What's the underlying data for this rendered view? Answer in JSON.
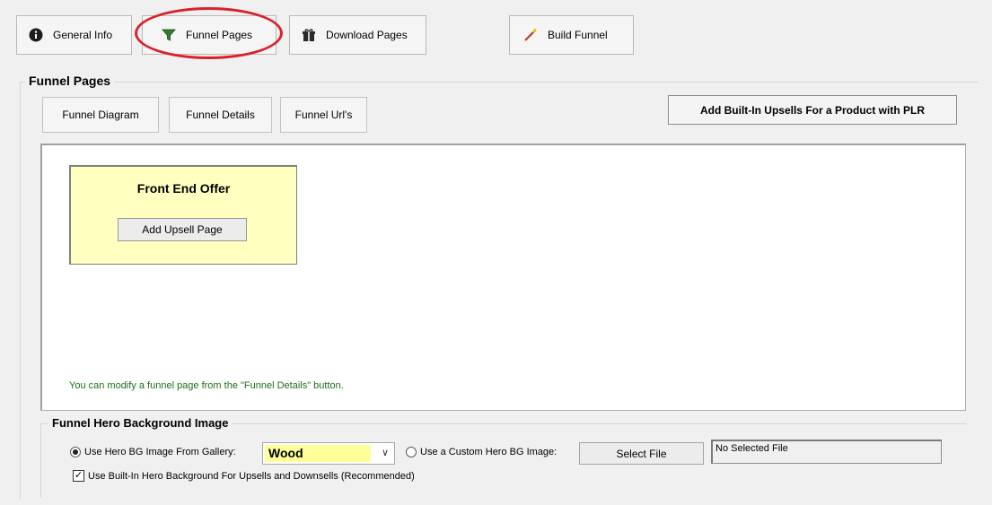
{
  "toolbar": {
    "general_info": "General Info",
    "funnel_pages": "Funnel Pages",
    "download_pages": "Download Pages",
    "build_funnel": "Build Funnel"
  },
  "group": {
    "title": "Funnel Pages"
  },
  "tabs": {
    "diagram": "Funnel Diagram",
    "details": "Funnel Details",
    "urls": "Funnel Url's"
  },
  "plr_button": "Add Built-In Upsells For a Product with PLR",
  "diagram": {
    "front_end_offer": "Front End Offer",
    "add_upsell": "Add Upsell Page",
    "hint": "You can modify a funnel page from the \"Funnel Details\" button."
  },
  "hero": {
    "title": "Funnel Hero Background Image",
    "gallery_label": "Use Hero BG Image From Gallery:",
    "gallery_value": "Wood",
    "custom_label": "Use a Custom Hero BG Image:",
    "select_file": "Select File",
    "file_value": "No Selected File",
    "builtin_label": "Use Built-In Hero Background For Upsells and Downsells (Recommended)"
  },
  "colors": {
    "highlight_ring": "#d8222a",
    "front_end_offer_bg": "#ffffc0",
    "hint_text": "#1b6e1b",
    "select_highlight": "#ffff99"
  }
}
